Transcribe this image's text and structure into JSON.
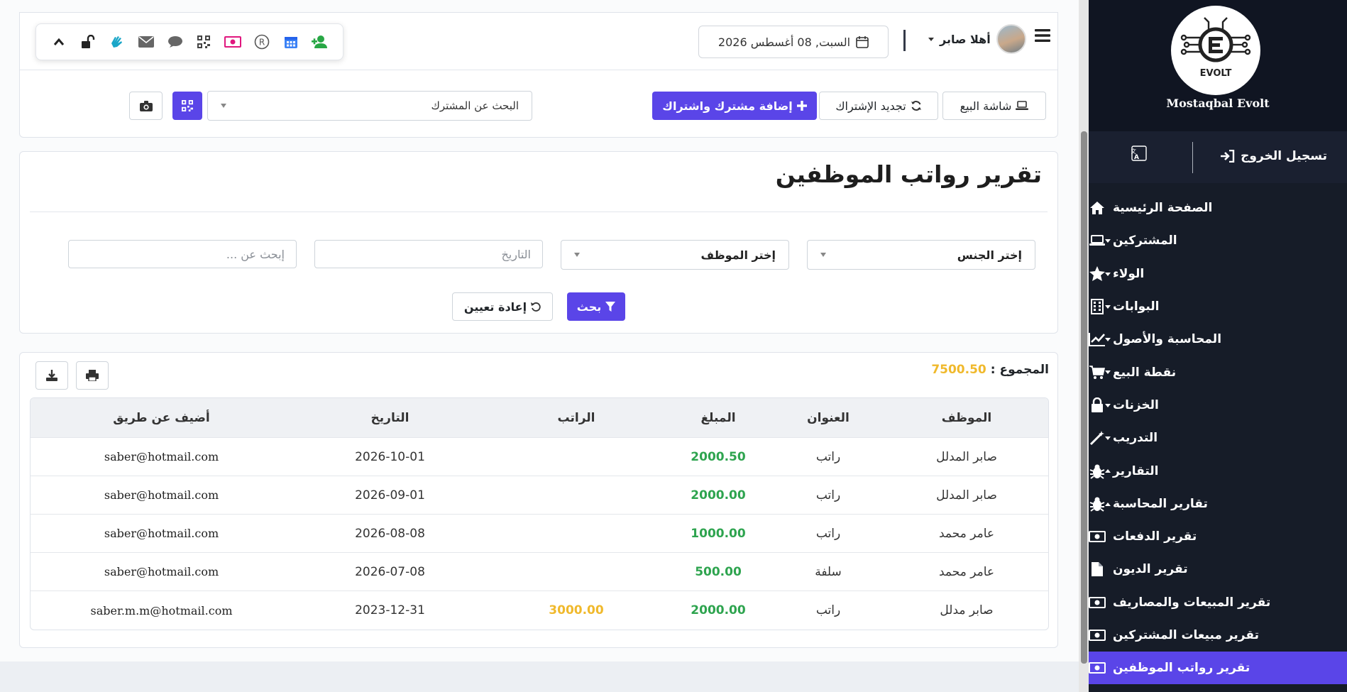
{
  "header": {
    "date_text": "السبت, 08 أغسطس 2026",
    "user_name": "أهلا صابر",
    "toolbox_icons": [
      "user-plus-icon",
      "calendar-icon",
      "registered-icon",
      "money-icon",
      "qrcode-icon",
      "comment-icon",
      "envelope-icon",
      "sign-language-icon",
      "unlock-icon",
      "chevron-up-icon"
    ],
    "pos_label": "شاشة البيع",
    "renew_label": "تجديد الإشتراك",
    "add_label": "إضافة مشترك واشتراك",
    "search_subscriber_placeholder": "البحث عن المشترك"
  },
  "filters": {
    "page_title": "تقرير رواتب الموظفين",
    "gender_select": "إختر الجنس",
    "employee_select": "إختر الموظف",
    "date_placeholder": "التاريخ",
    "search_placeholder": "إبحث عن ...",
    "search_button": "بحث",
    "reset_button": "إعادة تعيين"
  },
  "report": {
    "total_label": "المجموع :",
    "total_value": "7500.50",
    "columns": [
      "الموظف",
      "العنوان",
      "المبلغ",
      "الراتب",
      "التاريخ",
      "أضيف عن طريق"
    ],
    "rows": [
      {
        "employee": "صابر المدلل",
        "title": "راتب",
        "amount": "2000.50",
        "salary": "",
        "date": "2026-10-01",
        "added_by": "saber@hotmail.com"
      },
      {
        "employee": "صابر المدلل",
        "title": "راتب",
        "amount": "2000.00",
        "salary": "",
        "date": "2026-09-01",
        "added_by": "saber@hotmail.com"
      },
      {
        "employee": "عامر محمد",
        "title": "راتب",
        "amount": "1000.00",
        "salary": "",
        "date": "2026-08-08",
        "added_by": "saber@hotmail.com"
      },
      {
        "employee": "عامر محمد",
        "title": "سلفة",
        "amount": "500.00",
        "salary": "",
        "date": "2026-07-08",
        "added_by": "saber@hotmail.com"
      },
      {
        "employee": "صابر مدلل",
        "title": "راتب",
        "amount": "2000.00",
        "salary": "3000.00",
        "date": "2023-12-31",
        "added_by": "saber.m.m@hotmail.com"
      }
    ]
  },
  "sidebar": {
    "brand": "Mostaqbal Evolt",
    "logo_text": "EVOLT",
    "logout": "تسجيل الخروج",
    "items": [
      {
        "label": "الصفحة الرئيسية",
        "icon": "home-icon",
        "caret": ""
      },
      {
        "label": "المشتركين",
        "icon": "laptop-icon",
        "caret": "down"
      },
      {
        "label": "الولاء",
        "icon": "star-icon",
        "caret": "down"
      },
      {
        "label": "البوابات",
        "icon": "building-icon",
        "caret": "down"
      },
      {
        "label": "المحاسبة والأصول",
        "icon": "chart-line-icon",
        "caret": "down"
      },
      {
        "label": "نقطة البيع",
        "icon": "cart-icon",
        "caret": "down"
      },
      {
        "label": "الخزنات",
        "icon": "lock-icon",
        "caret": "down"
      },
      {
        "label": "التدريب",
        "icon": "magic-wand-icon",
        "caret": "down"
      },
      {
        "label": "التقارير",
        "icon": "bug-icon",
        "caret": "up"
      },
      {
        "label": "تقارير المحاسبة",
        "icon": "bug-icon",
        "caret": "up",
        "level": 1
      },
      {
        "label": "تقرير الدفعات",
        "icon": "money-icon",
        "caret": "",
        "level": 2
      },
      {
        "label": "تقرير الديون",
        "icon": "file-icon",
        "caret": "",
        "level": 2
      },
      {
        "label": "تقرير المبيعات والمصاريف",
        "icon": "money-icon",
        "caret": "",
        "level": 2
      },
      {
        "label": "تقرير مبيعات المشتركين",
        "icon": "money-icon",
        "caret": "",
        "level": 2
      },
      {
        "label": "تقرير رواتب الموظفين",
        "icon": "money-icon",
        "caret": "",
        "level": 2,
        "active": true
      }
    ]
  },
  "colors": {
    "primary": "#5a45e8",
    "amount": "#2ea44f",
    "highlight": "#f0b92c",
    "sidebar": "#161c28"
  }
}
